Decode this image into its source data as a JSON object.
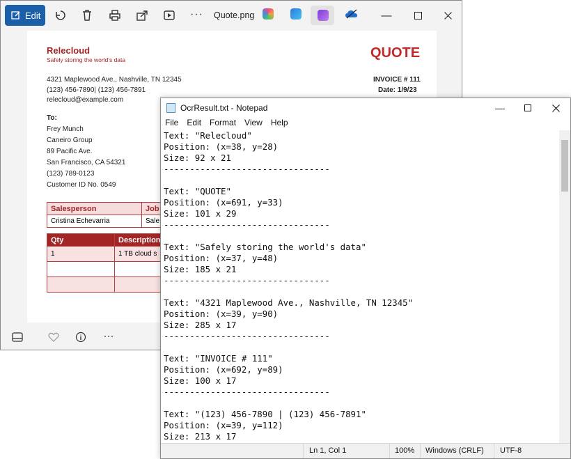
{
  "photos": {
    "edit_label": "Edit",
    "filename": "Quote.png",
    "more": "···",
    "toolbar_icons": [
      "rotate-icon",
      "delete-icon",
      "print-icon",
      "share-icon",
      "video-icon"
    ],
    "bottom_icons": [
      "filmstrip-icon",
      "heart-icon",
      "info-icon",
      "more-icon"
    ],
    "bottom_more": "···",
    "doc": {
      "company": "Relecloud",
      "tagline": "Safely storing the world's data",
      "quote": "QUOTE",
      "address": "4321 Maplewood Ave., Nashville, TN 12345",
      "phones": "(123) 456-7890| (123) 456-7891",
      "email": "relecloud@example.com",
      "invoice": "INVOICE # 111",
      "date": "Date: 1/9/23",
      "to_label": "To:",
      "to_lines": [
        "Frey Munch",
        "Caneiro Group",
        "89 Pacific Ave.",
        "San Francisco, CA 54321",
        "(123) 789-0123",
        "Customer ID No. 0549"
      ],
      "salesperson_header": "Salesperson",
      "job_header": "Job",
      "salesperson_value": "Cristina Echevarria",
      "job_value": "Sale",
      "qty_header": "Qty",
      "desc_header": "Description",
      "row1_qty": "1",
      "row1_desc": "1 TB cloud s"
    }
  },
  "notepad": {
    "title": "OcrResult.txt - Notepad",
    "menu": [
      "File",
      "Edit",
      "Format",
      "View",
      "Help"
    ],
    "content": "Text: \"Relecloud\"\nPosition: (x=38, y=28)\nSize: 92 x 21\n--------------------------------\n\nText: \"QUOTE\"\nPosition: (x=691, y=33)\nSize: 101 x 29\n--------------------------------\n\nText: \"Safely storing the world's data\"\nPosition: (x=37, y=48)\nSize: 185 x 21\n--------------------------------\n\nText: \"4321 Maplewood Ave., Nashville, TN 12345\"\nPosition: (x=39, y=90)\nSize: 285 x 17\n--------------------------------\n\nText: \"INVOICE # 111\"\nPosition: (x=692, y=89)\nSize: 100 x 17\n--------------------------------\n\nText: \"(123) 456-7890 | (123) 456-7891\"\nPosition: (x=39, y=112)\nSize: 213 x 17",
    "status": {
      "position": "Ln 1, Col 1",
      "zoom": "100%",
      "line_ending": "Windows (CRLF)",
      "encoding": "UTF-8"
    }
  }
}
